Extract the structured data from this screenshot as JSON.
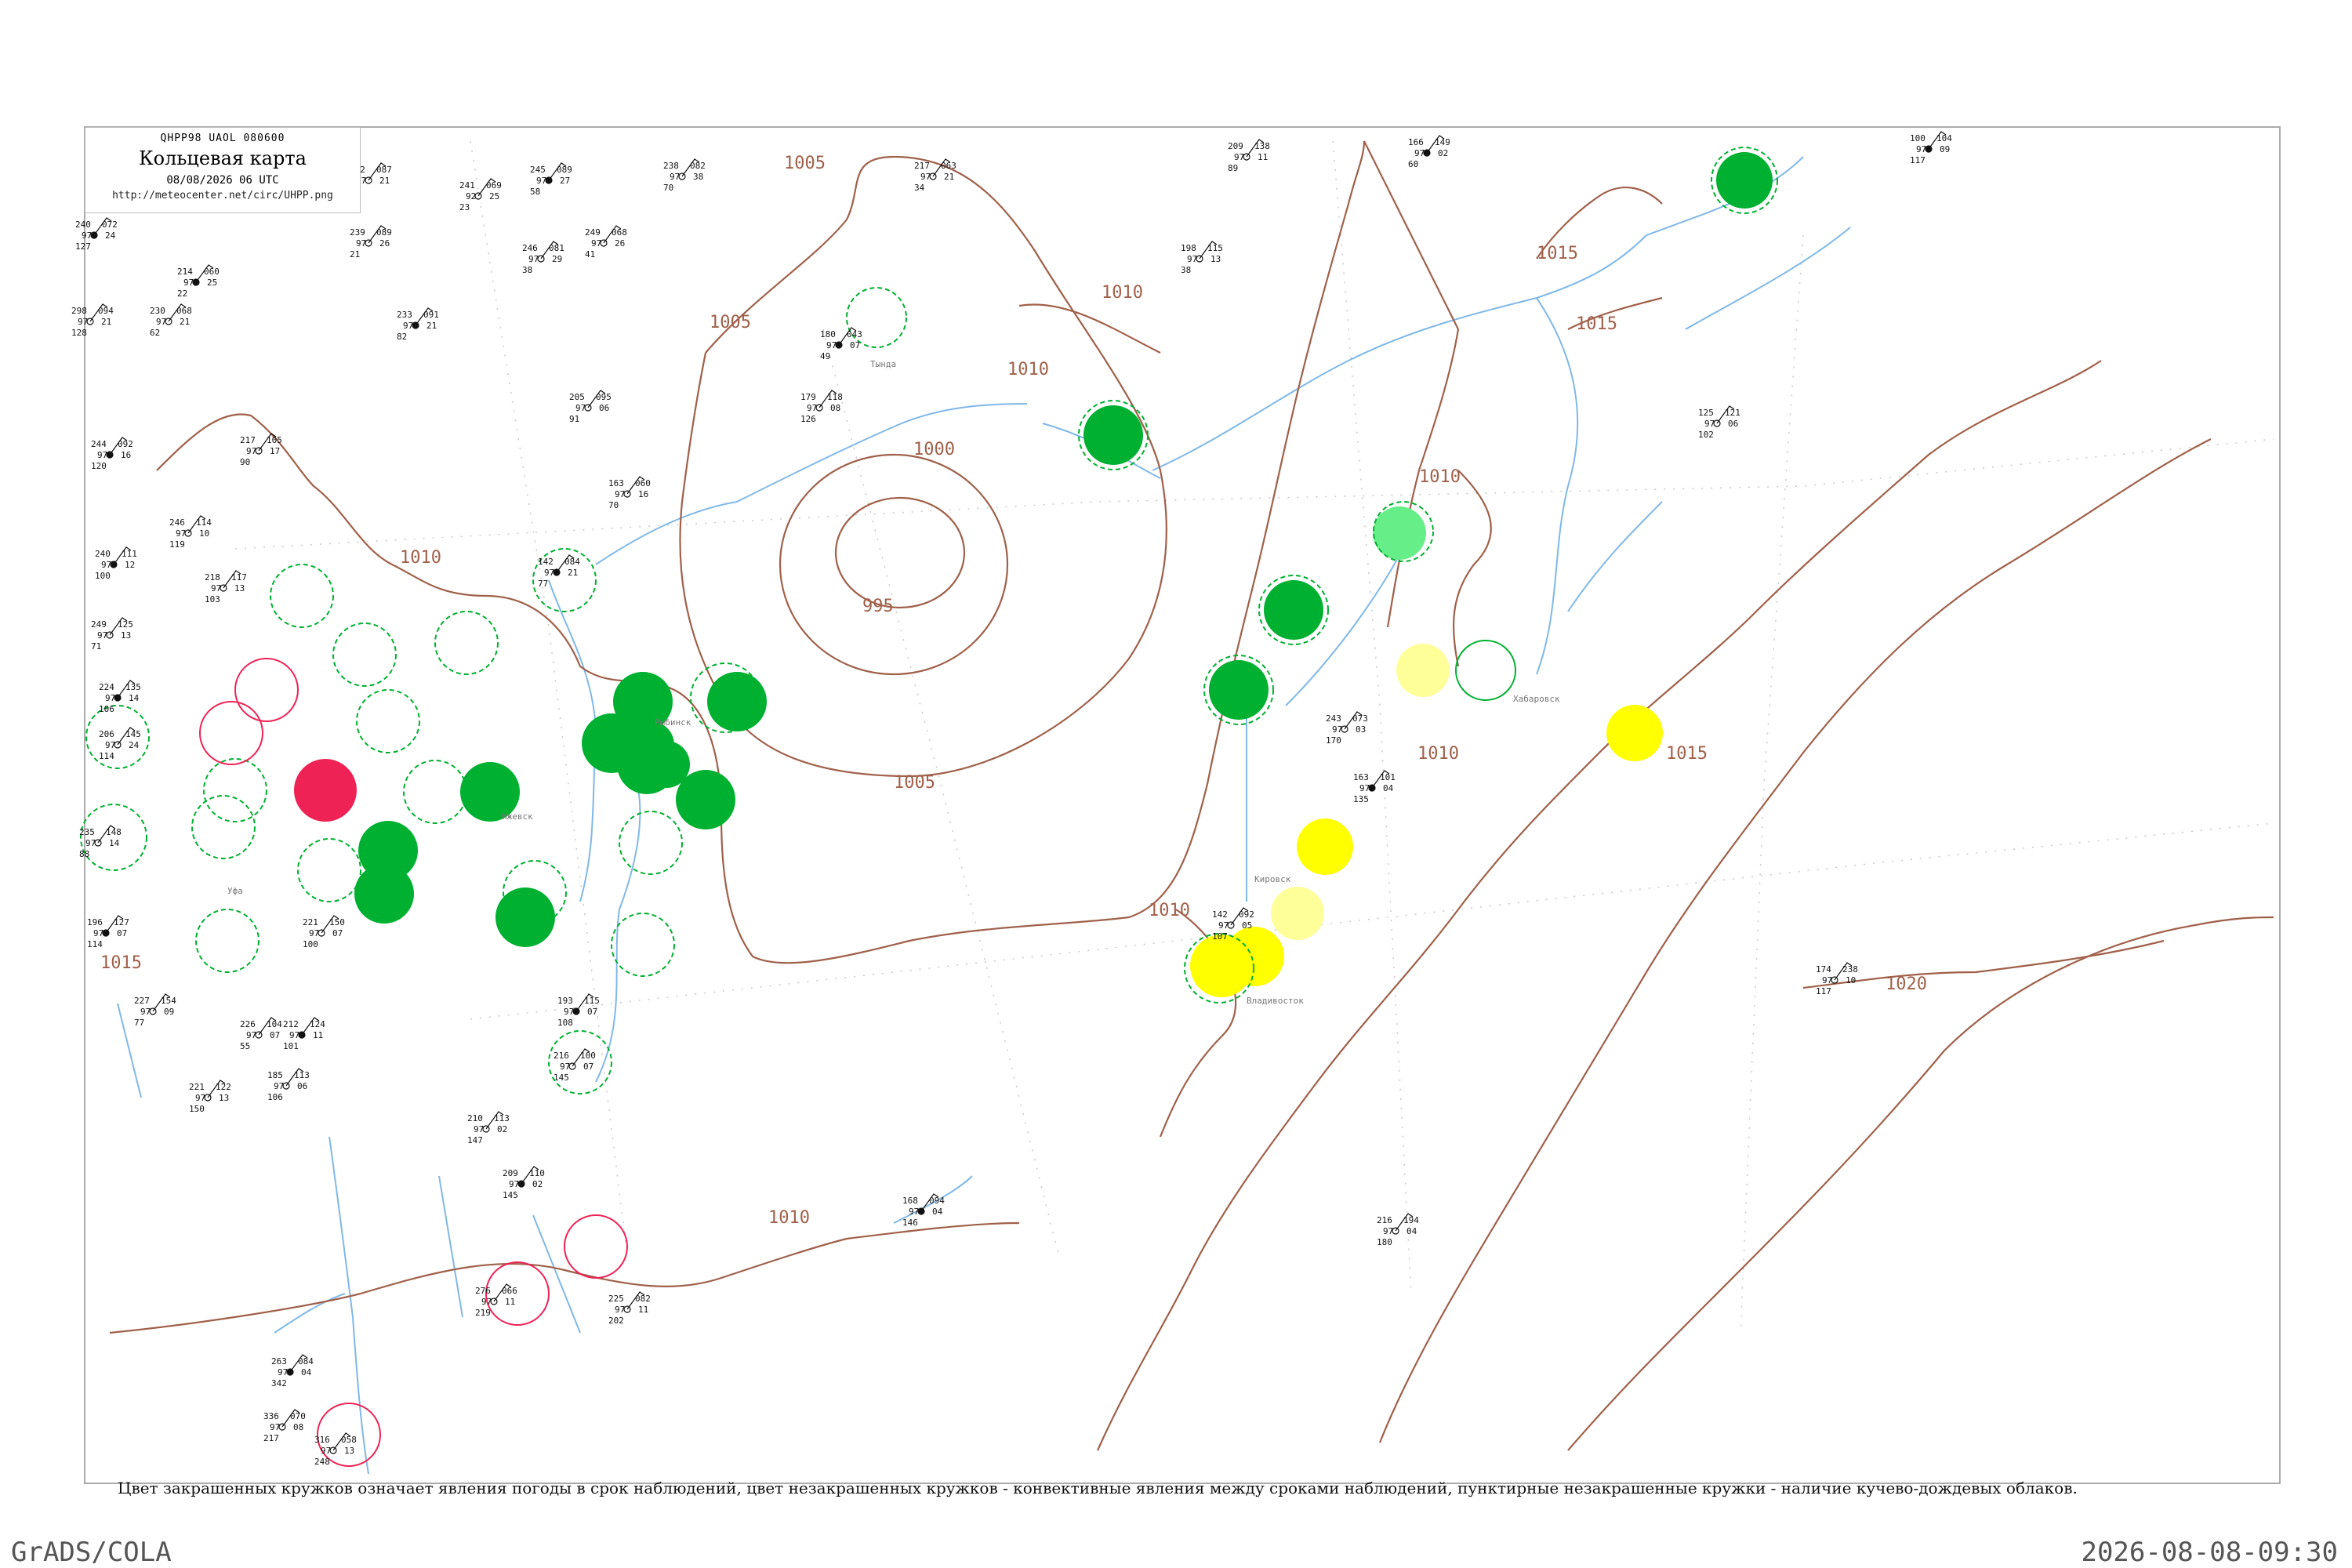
{
  "header": {
    "code": "QHPP98  UAOL  080600",
    "title": "Кольцевая карта",
    "date": "08/08/2026 06 UTC",
    "url": "http://meteocenter.net/circ/UHPP.png"
  },
  "caption": "Цвет закрашенных кружков означает явления погоды в срок наблюдений, цвет незакрашенных кружков - конвективные явления между сроками наблюдений, пунктирные незакрашенные кружки - наличие кучево-дождевых облаков.",
  "footer": {
    "left": "GrADS/COLA",
    "right": "2026-08-08-09:30"
  },
  "colors": {
    "isobar": "#a0604a",
    "water": "#7fb8e8",
    "green": "#00b030",
    "lightgreen": "#66ee88",
    "yellow": "#ffff00",
    "paleyellow": "#ffff99",
    "red": "#ee2255",
    "frame": "#aaaaaa"
  },
  "isobar_labels": [
    "1005",
    "1010",
    "1000",
    "995",
    "1005",
    "1005",
    "1010",
    "1015",
    "1015",
    "1010",
    "1010",
    "1015",
    "1010",
    "1010",
    "1020",
    "1010",
    "1015"
  ],
  "stations": [
    {
      "p": "240",
      "t": "97",
      "v": "127",
      "n": "072",
      "d": "24"
    },
    {
      "p": "252",
      "t": "97",
      "v": "95",
      "n": "087",
      "d": "21"
    },
    {
      "p": "241",
      "t": "92",
      "v": "23",
      "n": "069",
      "d": "25"
    },
    {
      "p": "245",
      "t": "97",
      "v": "58",
      "n": "089",
      "d": "27"
    },
    {
      "p": "238",
      "t": "97",
      "v": "70",
      "n": "082",
      "d": "38"
    },
    {
      "p": "239",
      "t": "97",
      "v": "21",
      "n": "089",
      "d": "26"
    },
    {
      "p": "214",
      "t": "97",
      "v": "22",
      "n": "060",
      "d": "25"
    },
    {
      "p": "298",
      "t": "97",
      "v": "128",
      "n": "094",
      "d": "21"
    },
    {
      "p": "230",
      "t": "97",
      "v": "62",
      "n": "068",
      "d": "21"
    },
    {
      "p": "233",
      "t": "97",
      "v": "82",
      "n": "091",
      "d": "21"
    },
    {
      "p": "246",
      "t": "97",
      "v": "38",
      "n": "081",
      "d": "29"
    },
    {
      "p": "249",
      "t": "97",
      "v": "41",
      "n": "068",
      "d": "26"
    },
    {
      "p": "180",
      "t": "97",
      "v": "49",
      "n": "043",
      "d": "07"
    },
    {
      "p": "179",
      "t": "97",
      "v": "126",
      "n": "118",
      "d": "08"
    },
    {
      "p": "205",
      "t": "97",
      "v": "91",
      "n": "095",
      "d": "06"
    },
    {
      "p": "244",
      "t": "97",
      "v": "120",
      "n": "092",
      "d": "16"
    },
    {
      "p": "217",
      "t": "97",
      "v": "90",
      "n": "105",
      "d": "17"
    },
    {
      "p": "246",
      "t": "97",
      "v": "119",
      "n": "114",
      "d": "10"
    },
    {
      "p": "240",
      "t": "97",
      "v": "100",
      "n": "111",
      "d": "12"
    },
    {
      "p": "218",
      "t": "97",
      "v": "103",
      "n": "117",
      "d": "13"
    },
    {
      "p": "249",
      "t": "97",
      "v": "71",
      "n": "125",
      "d": "13"
    },
    {
      "p": "224",
      "t": "97",
      "v": "106",
      "n": "135",
      "d": "14"
    },
    {
      "p": "206",
      "t": "97",
      "v": "114",
      "n": "145",
      "d": "24"
    },
    {
      "p": "235",
      "t": "97",
      "v": "88",
      "n": "148",
      "d": "14"
    },
    {
      "p": "142",
      "t": "97",
      "v": "77",
      "n": "084",
      "d": "21"
    },
    {
      "p": "163",
      "t": "97",
      "v": "70",
      "n": "060",
      "d": "16"
    },
    {
      "p": "209",
      "t": "97",
      "v": "89",
      "n": "138",
      "d": "11"
    },
    {
      "p": "166",
      "t": "97",
      "v": "60",
      "n": "149",
      "d": "02"
    },
    {
      "p": "198",
      "t": "97",
      "v": "38",
      "n": "115",
      "d": "13"
    },
    {
      "p": "217",
      "t": "97",
      "v": "34",
      "n": "063",
      "d": "21"
    },
    {
      "p": "100",
      "t": "97",
      "v": "117",
      "n": "104",
      "d": "09"
    },
    {
      "p": "125",
      "t": "97",
      "v": "102",
      "n": "121",
      "d": "06"
    },
    {
      "p": "243",
      "t": "97",
      "v": "170",
      "n": "073",
      "d": "03"
    },
    {
      "p": "163",
      "t": "97",
      "v": "135",
      "n": "101",
      "d": "04"
    },
    {
      "p": "142",
      "t": "97",
      "v": "107",
      "n": "092",
      "d": "05"
    },
    {
      "p": "174",
      "t": "97",
      "v": "117",
      "n": "238",
      "d": "10"
    },
    {
      "p": "168",
      "t": "97",
      "v": "146",
      "n": "094",
      "d": "04"
    },
    {
      "p": "216",
      "t": "97",
      "v": "180",
      "n": "194",
      "d": "04"
    },
    {
      "p": "210",
      "t": "97",
      "v": "147",
      "n": "113",
      "d": "02"
    },
    {
      "p": "209",
      "t": "97",
      "v": "145",
      "n": "110",
      "d": "02"
    },
    {
      "p": "276",
      "t": "97",
      "v": "219",
      "n": "066",
      "d": "11"
    },
    {
      "p": "225",
      "t": "97",
      "v": "202",
      "n": "082",
      "d": "11"
    },
    {
      "p": "263",
      "t": "97",
      "v": "342",
      "n": "084",
      "d": "04"
    },
    {
      "p": "336",
      "t": "97",
      "v": "217",
      "n": "070",
      "d": "08"
    },
    {
      "p": "316",
      "t": "97",
      "v": "248",
      "n": "058",
      "d": "13"
    },
    {
      "p": "193",
      "t": "97",
      "v": "108",
      "n": "115",
      "d": "07"
    },
    {
      "p": "216",
      "t": "97",
      "v": "145",
      "n": "100",
      "d": "07"
    },
    {
      "p": "221",
      "t": "97",
      "v": "150",
      "n": "122",
      "d": "13"
    },
    {
      "p": "196",
      "t": "97",
      "v": "114",
      "n": "127",
      "d": "07"
    },
    {
      "p": "227",
      "t": "97",
      "v": "77",
      "n": "154",
      "d": "09"
    },
    {
      "p": "221",
      "t": "97",
      "v": "100",
      "n": "150",
      "d": "07"
    },
    {
      "p": "212",
      "t": "97",
      "v": "101",
      "n": "124",
      "d": "11"
    },
    {
      "p": "185",
      "t": "97",
      "v": "106",
      "n": "113",
      "d": "06"
    },
    {
      "p": "226",
      "t": "97",
      "v": "55",
      "n": "104",
      "d": "07"
    }
  ],
  "filled_circles": [
    {
      "color": "green"
    },
    {
      "color": "green"
    },
    {
      "color": "green"
    },
    {
      "color": "green"
    },
    {
      "color": "green"
    },
    {
      "color": "green"
    },
    {
      "color": "green"
    },
    {
      "color": "green"
    },
    {
      "color": "green"
    },
    {
      "color": "green"
    },
    {
      "color": "green"
    },
    {
      "color": "green"
    },
    {
      "color": "green"
    },
    {
      "color": "green"
    },
    {
      "color": "lightgreen"
    },
    {
      "color": "red"
    },
    {
      "color": "yellow"
    },
    {
      "color": "yellow"
    },
    {
      "color": "yellow"
    },
    {
      "color": "yellow"
    },
    {
      "color": "paleyellow"
    },
    {
      "color": "paleyellow"
    }
  ],
  "place_names": [
    "Рыбинск",
    "Ижевск",
    "Уфа",
    "Владивосток",
    "Хабаровск",
    "Тында",
    "Кировск"
  ]
}
